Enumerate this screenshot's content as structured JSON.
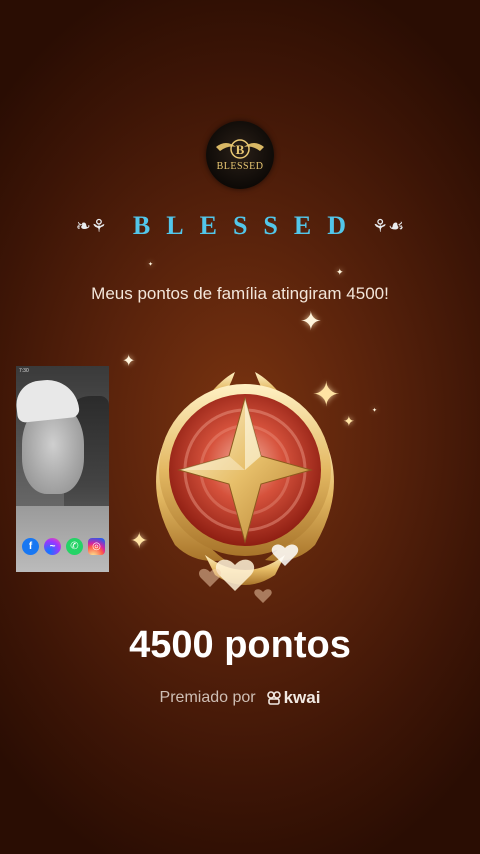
{
  "family": {
    "logo_text": "BLESSED",
    "name": "BLESSED",
    "left_ornament": "❧⚘",
    "right_ornament": "⚘☙"
  },
  "headline": "Meus pontos de família atingiram 4500!",
  "points_label": "4500 pontos",
  "awarded": {
    "prefix": "Premiado por",
    "brand": "kwai"
  },
  "pip": {
    "status_time": "7:30",
    "apps": [
      "facebook-icon",
      "messenger-icon",
      "whatsapp-icon",
      "instagram-icon"
    ]
  },
  "colors": {
    "name_color": "#52c6ea",
    "gold": "#e9c873",
    "medal_red": "#c0392b"
  }
}
